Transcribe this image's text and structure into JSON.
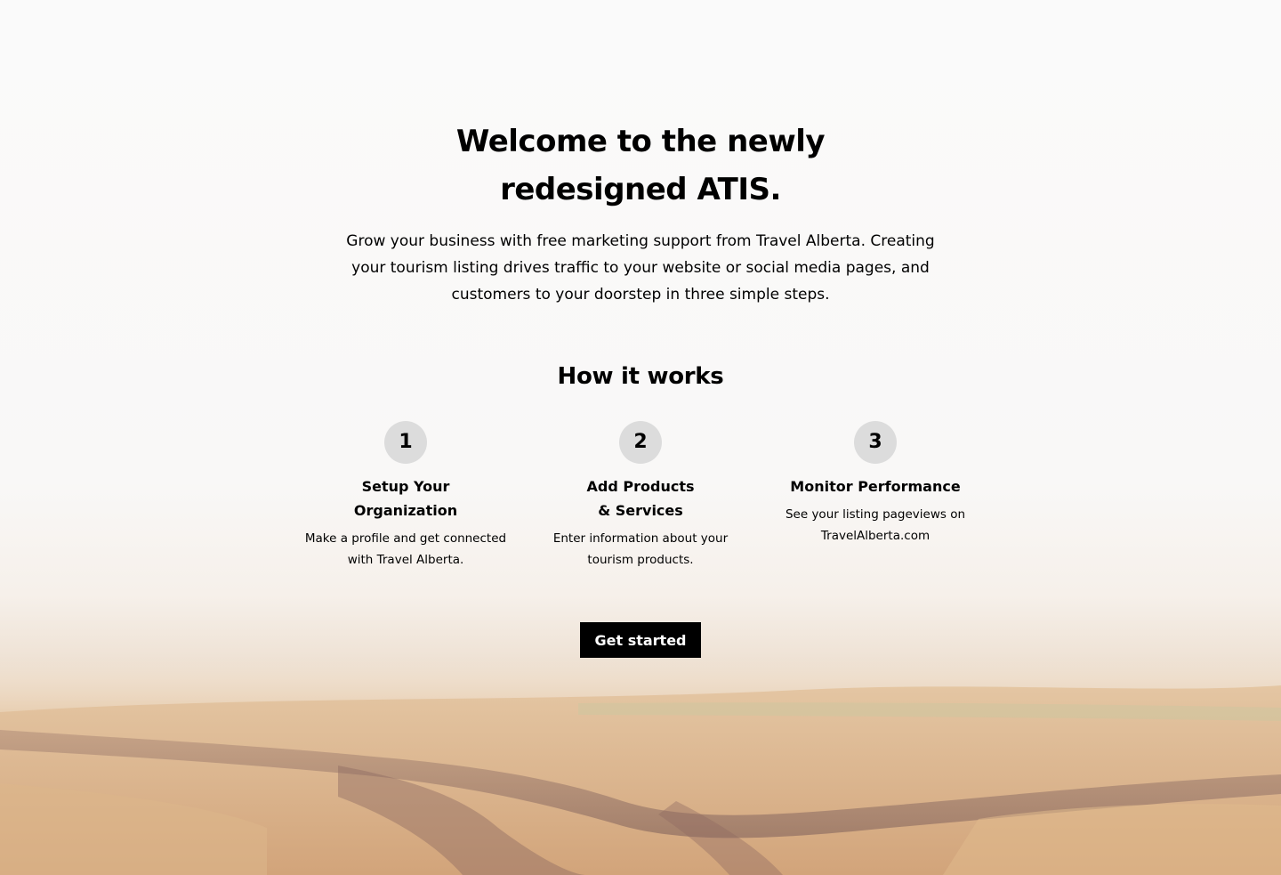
{
  "hero": {
    "title_line1": "Welcome to the newly",
    "title_line2": "redesigned ATIS.",
    "intro": "Grow your business with free marketing support from Travel Alberta. Creating your tourism listing drives traffic to your website or social media pages, and customers to your doorstep in three simple steps."
  },
  "how_it_works": {
    "title": "How it works",
    "steps": [
      {
        "number": "1",
        "title_line1": "Setup Your",
        "title_line2": "Organization",
        "description": "Make a profile and get connected with Travel Alberta."
      },
      {
        "number": "2",
        "title_line1": "Add Products",
        "title_line2": "& Services",
        "description": "Enter information about your tourism products."
      },
      {
        "number": "3",
        "title_line1": "Monitor Performance",
        "title_line2": "",
        "description": "See your listing pageviews on TravelAlberta.com"
      }
    ]
  },
  "cta": {
    "label": "Get started"
  },
  "colors": {
    "button_bg": "#000000",
    "step_circle": "#dcdcdc",
    "landscape_sand": "#d6ad84"
  }
}
